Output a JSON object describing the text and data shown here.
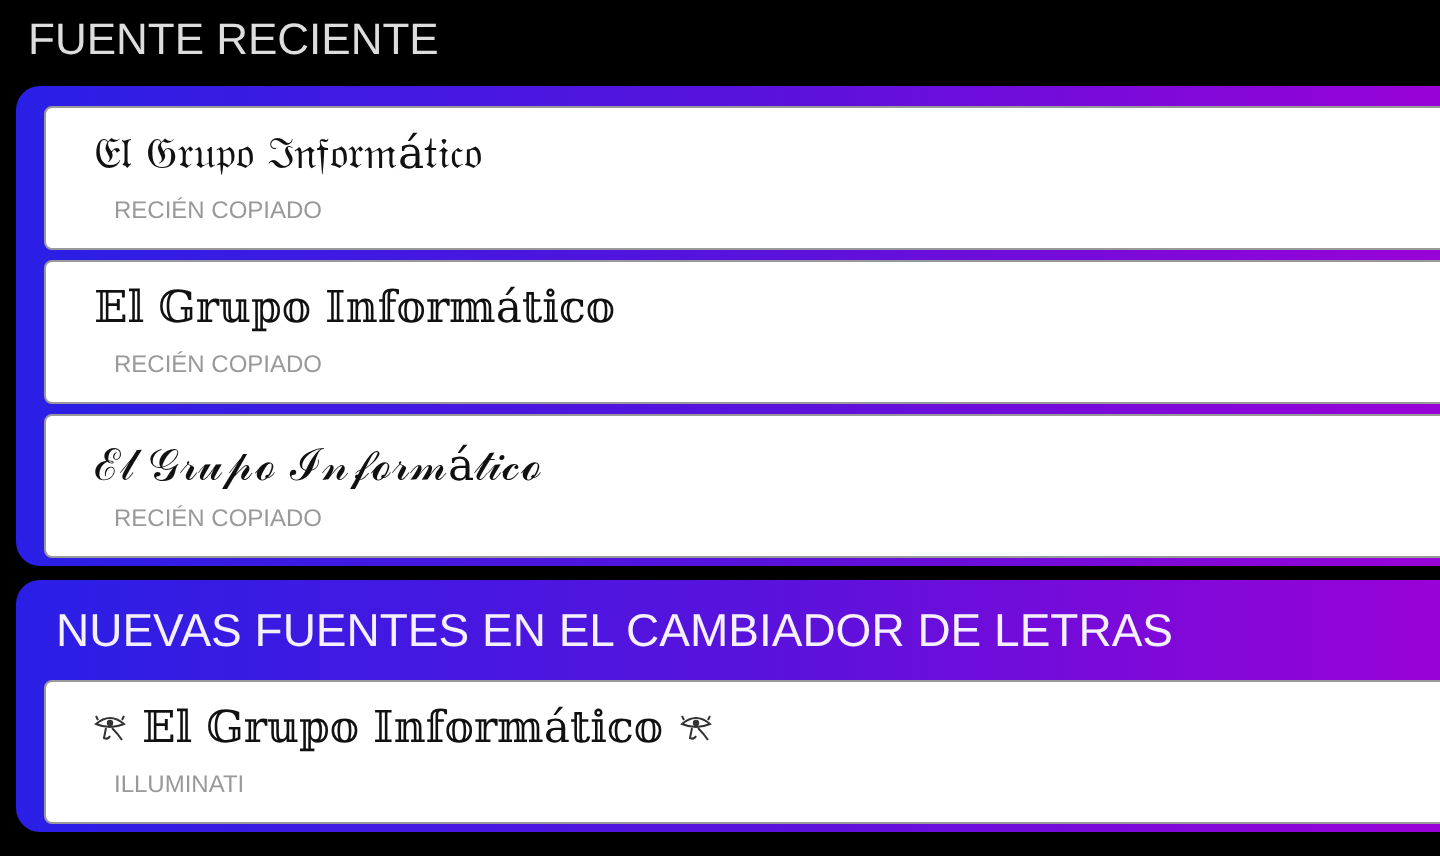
{
  "recent": {
    "title": "FUENTE RECIENTE",
    "items": [
      {
        "text": "𝔈𝔩 𝔊𝔯𝔲𝔭𝔬 ℑ𝔫𝔣𝔬𝔯𝔪á𝔱𝔦𝔠𝔬",
        "label": "RECIÉN COPIADO"
      },
      {
        "text": "𝔼𝕝 𝔾𝕣𝕦𝕡𝕠 𝕀𝕟𝕗𝕠𝕣𝕞á𝕥𝕚𝕔𝕠",
        "label": "RECIÉN COPIADO"
      },
      {
        "text": "ℰ𝓁 𝒢𝓇𝓊𝓅ℴ ℐ𝓃𝒻ℴ𝓇𝓂á𝓉𝒾𝒸ℴ",
        "label": "RECIÉN COPIADO"
      }
    ]
  },
  "new_fonts": {
    "title": "NUEVAS FUENTES EN EL CAMBIADOR DE LETRAS",
    "items": [
      {
        "text": "𝔼𝕝 𝔾𝕣𝕦𝕡𝕠 𝕀𝕟𝕗𝕠𝕣𝕞á𝕥𝕚𝕔𝕠",
        "label": "ILLUMINATI",
        "kind": "eyes"
      }
    ]
  }
}
